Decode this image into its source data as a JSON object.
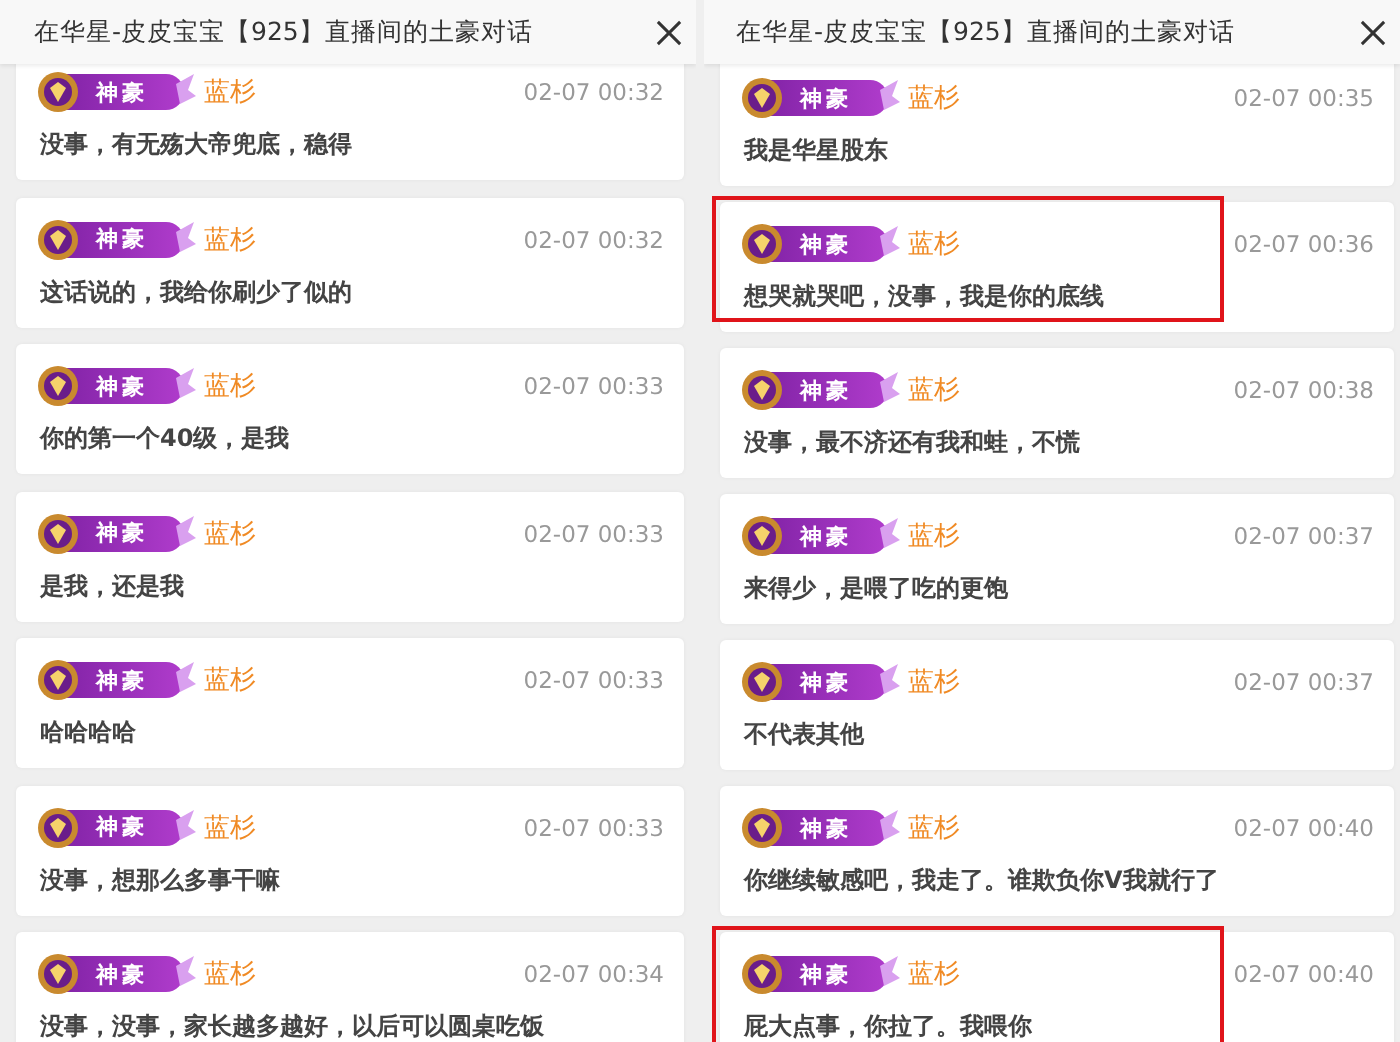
{
  "panels": [
    {
      "title": "在华星-皮皮宝宝【925】直播间的土豪对话",
      "messages": [
        {
          "badge": "神豪",
          "user": "蓝杉",
          "time": "02-07 00:32",
          "text": "没事，有无殇大帝兜底，稳得",
          "highlighted": false
        },
        {
          "badge": "神豪",
          "user": "蓝杉",
          "time": "02-07 00:32",
          "text": "这话说的，我给你刷少了似的",
          "highlighted": false
        },
        {
          "badge": "神豪",
          "user": "蓝杉",
          "time": "02-07 00:33",
          "text": "你的第一个40级，是我",
          "highlighted": false
        },
        {
          "badge": "神豪",
          "user": "蓝杉",
          "time": "02-07 00:33",
          "text": "是我，还是我",
          "highlighted": false
        },
        {
          "badge": "神豪",
          "user": "蓝杉",
          "time": "02-07 00:33",
          "text": "哈哈哈哈",
          "highlighted": false
        },
        {
          "badge": "神豪",
          "user": "蓝杉",
          "time": "02-07 00:33",
          "text": "没事，想那么多事干嘛",
          "highlighted": false
        },
        {
          "badge": "神豪",
          "user": "蓝杉",
          "time": "02-07 00:34",
          "text": "没事，没事，家长越多越好，以后可以圆桌吃饭",
          "highlighted": false
        }
      ]
    },
    {
      "title": "在华星-皮皮宝宝【925】直播间的土豪对话",
      "messages": [
        {
          "badge": "神豪",
          "user": "蓝杉",
          "time": "02-07 00:35",
          "text": "我是华星股东",
          "highlighted": false
        },
        {
          "badge": "神豪",
          "user": "蓝杉",
          "time": "02-07 00:36",
          "text": "想哭就哭吧，没事，我是你的底线",
          "highlighted": true
        },
        {
          "badge": "神豪",
          "user": "蓝杉",
          "time": "02-07 00:38",
          "text": "没事，最不济还有我和蛙，不慌",
          "highlighted": false
        },
        {
          "badge": "神豪",
          "user": "蓝杉",
          "time": "02-07 00:37",
          "text": "来得少，是喂了吃的更饱",
          "highlighted": false
        },
        {
          "badge": "神豪",
          "user": "蓝杉",
          "time": "02-07 00:37",
          "text": "不代表其他",
          "highlighted": false
        },
        {
          "badge": "神豪",
          "user": "蓝杉",
          "time": "02-07 00:40",
          "text": "你继续敏感吧，我走了。谁欺负你V我就行了",
          "highlighted": false
        },
        {
          "badge": "神豪",
          "user": "蓝杉",
          "time": "02-07 00:40",
          "text": "屁大点事，你拉了。我喂你",
          "highlighted": true
        }
      ]
    }
  ]
}
